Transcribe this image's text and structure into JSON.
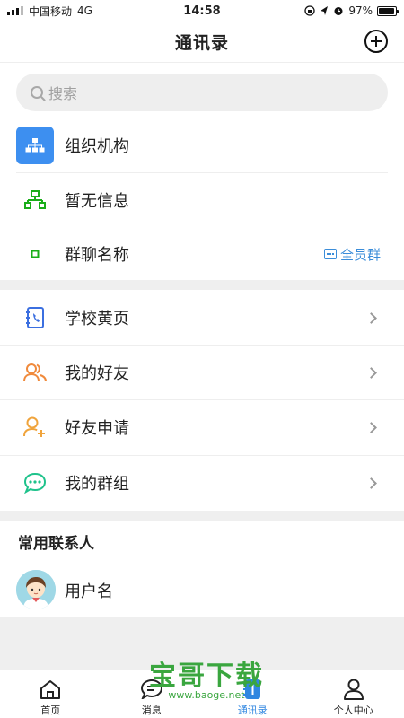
{
  "status": {
    "carrier": "中国移动",
    "network": "4G",
    "time": "14:58",
    "battery": "97%",
    "battery_level": 0.97
  },
  "nav": {
    "title": "通讯录",
    "add_icon": "plus-circle-icon"
  },
  "search": {
    "placeholder": "搜索",
    "icon": "search-icon"
  },
  "top_rows": [
    {
      "label": "组织机构",
      "icon": "org-chart-icon"
    },
    {
      "label": "暂无信息",
      "icon": "hierarchy-icon"
    },
    {
      "label": "群聊名称",
      "icon": "dot-icon",
      "tag": "全员群",
      "tag_icon": "chat-icon"
    }
  ],
  "menu_rows": [
    {
      "label": "学校黄页",
      "icon": "phonebook-icon"
    },
    {
      "label": "我的好友",
      "icon": "friends-icon"
    },
    {
      "label": "好友申请",
      "icon": "add-friend-icon"
    },
    {
      "label": "我的群组",
      "icon": "group-chat-icon"
    }
  ],
  "frequent": {
    "title": "常用联系人",
    "contacts": [
      {
        "name": "用户名"
      }
    ]
  },
  "tabs": [
    {
      "label": "首页",
      "icon": "home-icon"
    },
    {
      "label": "消息",
      "icon": "message-icon"
    },
    {
      "label": "通讯录",
      "icon": "contacts-icon",
      "active": true
    },
    {
      "label": "个人中心",
      "icon": "user-icon"
    }
  ],
  "watermark": {
    "text": "宝哥下载",
    "url": "www.baoge.net"
  },
  "colors": {
    "accent": "#2f86e0",
    "org_icon_bg": "#3d8ff0",
    "green": "#1aad19",
    "orange": "#f08a3c",
    "teal": "#1ec28b"
  }
}
